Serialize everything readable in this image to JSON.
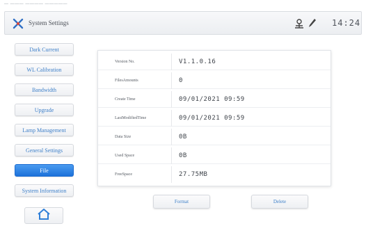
{
  "top_strip": {
    "text": "— ——— ———— —————"
  },
  "header": {
    "title": "System Settings",
    "clock": "14:24",
    "icons": [
      "system-settings-icon",
      "network-icon",
      "pen-icon"
    ]
  },
  "sidebar": {
    "items": [
      {
        "label": "Dark Current",
        "active": false
      },
      {
        "label": "WL Calibration",
        "active": false
      },
      {
        "label": "Bandwidth",
        "active": false
      },
      {
        "label": "Upgrade",
        "active": false
      },
      {
        "label": "Lamp Management",
        "active": false
      },
      {
        "label": "General Settings",
        "active": false
      },
      {
        "label": "File",
        "active": true
      },
      {
        "label": "System Information",
        "active": false
      }
    ],
    "home_icon": "home-icon"
  },
  "file_info": {
    "rows": [
      {
        "label": "Version No.",
        "value": "V1.1.0.16"
      },
      {
        "label": "FilesAmounts",
        "value": "0"
      },
      {
        "label": "Create Time",
        "value": "09/01/2021 09:59"
      },
      {
        "label": "LastModifiedTime",
        "value": "09/01/2021 09:59"
      },
      {
        "label": "Data Size",
        "value": "0B"
      },
      {
        "label": "Used Space",
        "value": "0B"
      },
      {
        "label": "FreeSpace",
        "value": "27.75MB"
      }
    ]
  },
  "actions": {
    "format_label": "Format",
    "delete_label": "Delete"
  },
  "colors": {
    "accent": "#1d72da",
    "link_text": "#3d7fc8",
    "panel_border": "#e1e4e8"
  }
}
